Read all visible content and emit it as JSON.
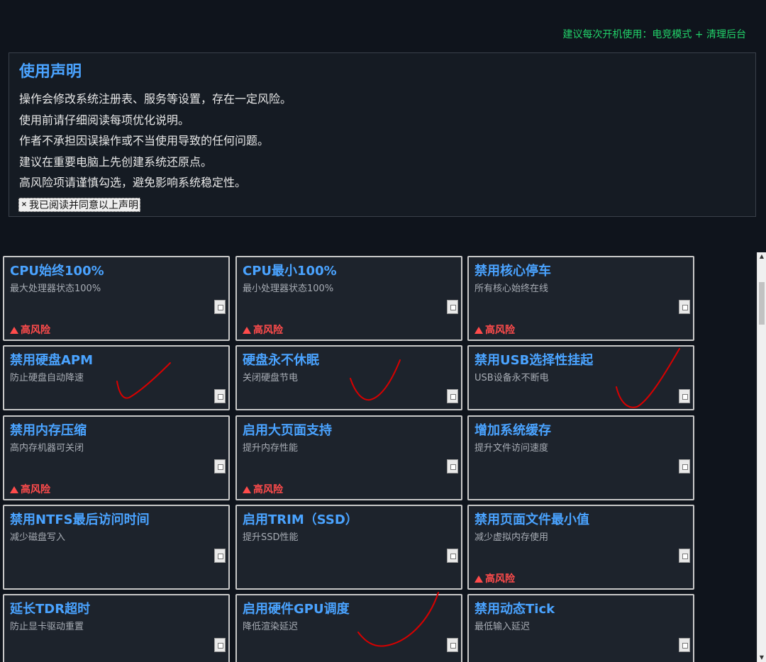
{
  "tip": "建议每次开机使用：电竞模式 + 清理后台",
  "disclaimer": {
    "title": "使用声明",
    "lines": [
      "操作会修改系统注册表、服务等设置，存在一定风险。",
      "使用前请仔细阅读每项优化说明。",
      "作者不承担因误操作或不当使用导致的任何问题。",
      "建议在重要电脑上先创建系统还原点。",
      "高风险项请谨慎勾选，避免影响系统稳定性。"
    ],
    "agree_mark": "×",
    "agree_label": "我已阅读并同意以上声明"
  },
  "risk_label": "高风险",
  "cards": [
    {
      "title": "CPU始终100%",
      "desc": "最大处理器状态100%",
      "high_risk": true,
      "checked": false
    },
    {
      "title": "CPU最小100%",
      "desc": "最小处理器状态100%",
      "high_risk": true,
      "checked": false
    },
    {
      "title": "禁用核心停车",
      "desc": "所有核心始终在线",
      "high_risk": true,
      "checked": false
    },
    {
      "title": "禁用硬盘APM",
      "desc": "防止硬盘自动降速",
      "high_risk": false,
      "checked": false
    },
    {
      "title": "硬盘永不休眠",
      "desc": "关闭硬盘节电",
      "high_risk": false,
      "checked": false
    },
    {
      "title": "禁用USB选择性挂起",
      "desc": "USB设备永不断电",
      "high_risk": false,
      "checked": false
    },
    {
      "title": "禁用内存压缩",
      "desc": "高内存机器可关闭",
      "high_risk": true,
      "checked": false
    },
    {
      "title": "启用大页面支持",
      "desc": "提升内存性能",
      "high_risk": true,
      "checked": false
    },
    {
      "title": "增加系统缓存",
      "desc": "提升文件访问速度",
      "high_risk": false,
      "checked": false
    },
    {
      "title": "禁用NTFS最后访问时间",
      "desc": "减少磁盘写入",
      "high_risk": false,
      "checked": false
    },
    {
      "title": "启用TRIM（SSD）",
      "desc": "提升SSD性能",
      "high_risk": false,
      "checked": false
    },
    {
      "title": "禁用页面文件最小值",
      "desc": "减少虚拟内存使用",
      "high_risk": true,
      "checked": false
    },
    {
      "title": "延长TDR超时",
      "desc": "防止显卡驱动重置",
      "high_risk": true,
      "checked": false
    },
    {
      "title": "启用硬件GPU调度",
      "desc": "降低渲染延迟",
      "high_risk": false,
      "checked": false
    },
    {
      "title": "禁用动态Tick",
      "desc": "最低输入延迟",
      "high_risk": true,
      "checked": false
    }
  ],
  "colors": {
    "background": "#0f141c",
    "accent": "#4aa3ff",
    "tip": "#22d36a",
    "risk": "#ff4b4b",
    "annotation": "#d80000"
  }
}
